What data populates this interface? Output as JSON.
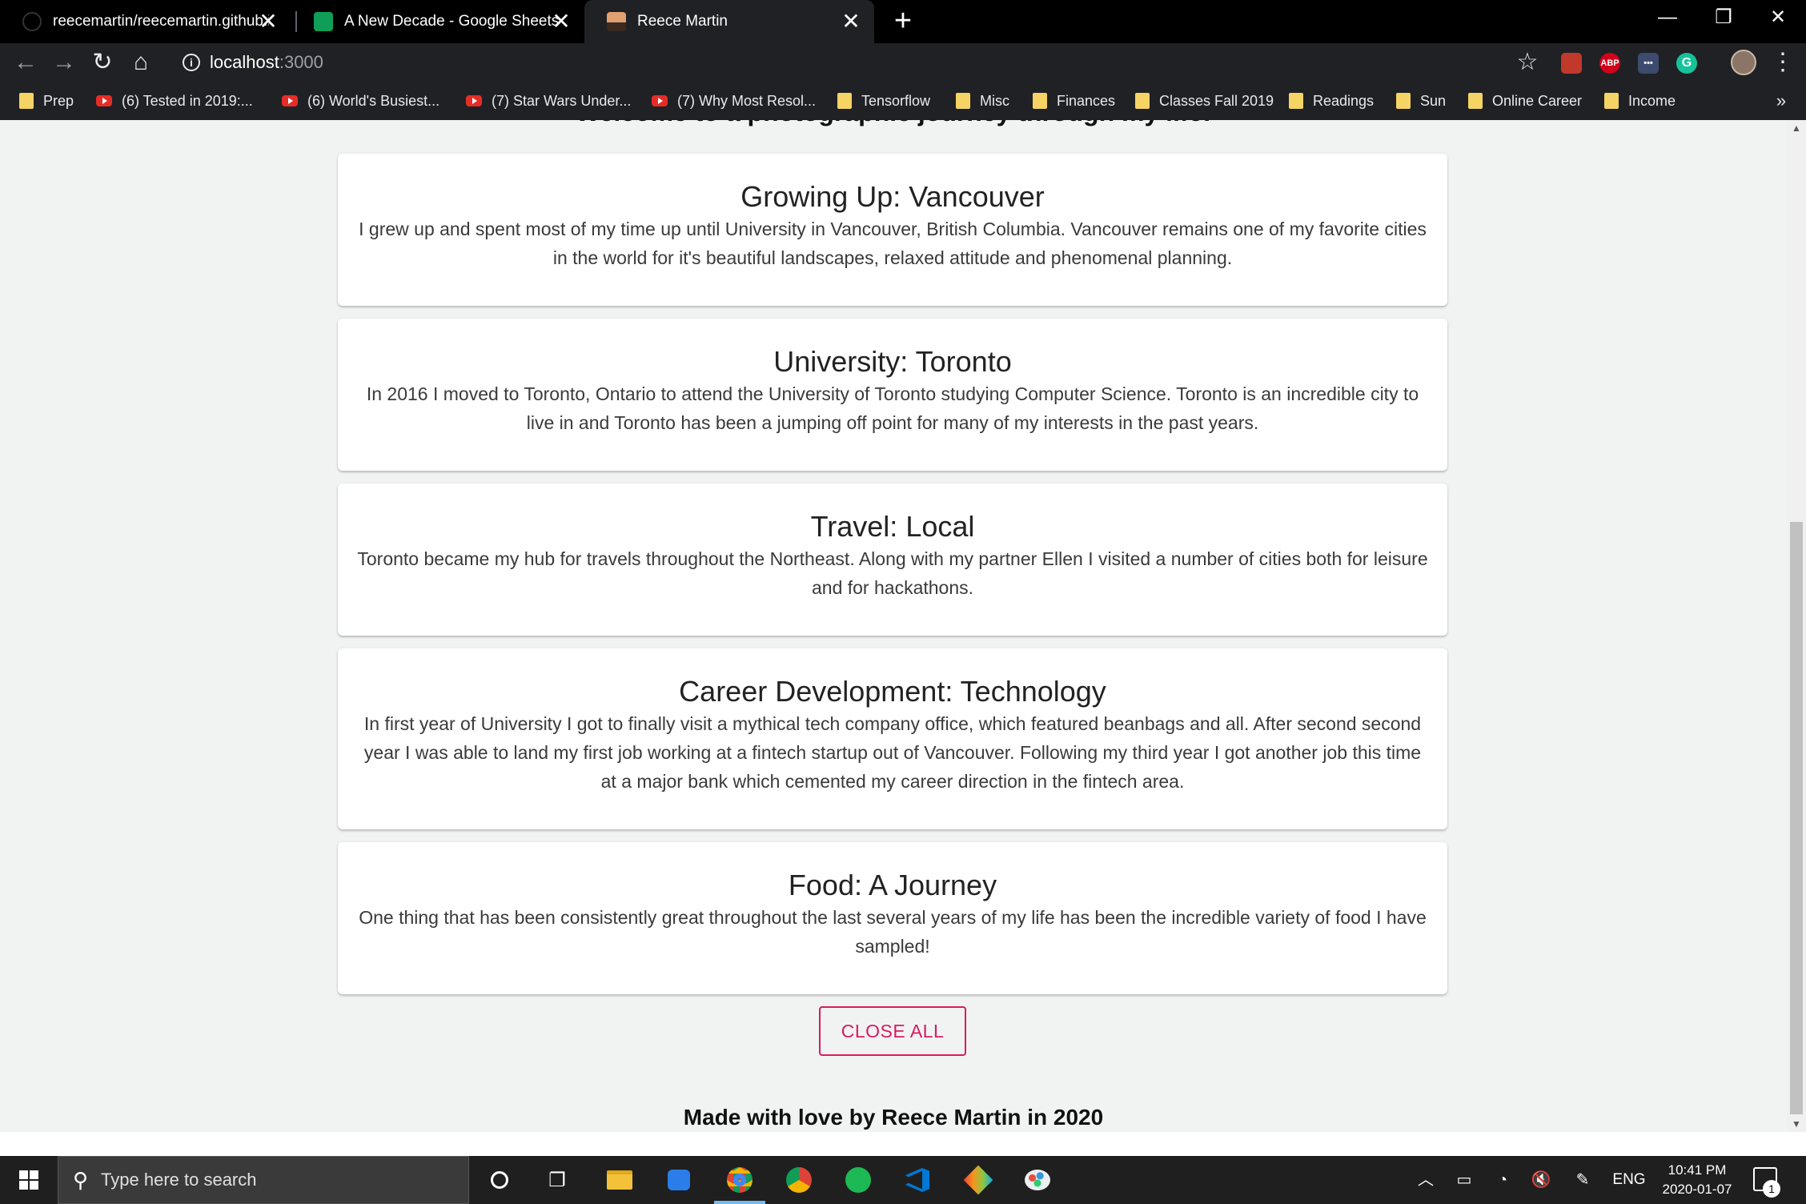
{
  "browser": {
    "tabs": [
      {
        "title": "reecemartin/reecemartin.github.i",
        "icon": "github-icon",
        "active": false
      },
      {
        "title": "A New Decade - Google Sheets",
        "icon": "google-sheets-icon",
        "active": false
      },
      {
        "title": "Reece Martin",
        "icon": "site-favicon",
        "active": true
      }
    ],
    "tab_close_glyph": "✕",
    "new_tab_glyph": "+",
    "window_controls": {
      "minimize": "—",
      "restore": "❐",
      "close": "✕"
    },
    "address": {
      "host": "localhost",
      "port": ":3000"
    },
    "nav": {
      "back": "←",
      "forward": "→",
      "reload": "↻",
      "home": "⌂",
      "bookmark_star": "☆",
      "menu": "⋮"
    },
    "extensions": [
      {
        "name": "extension-icon",
        "label": "",
        "color": "#c0392b"
      },
      {
        "name": "adblock-plus-icon",
        "label": "ABP",
        "color": "#d0021b"
      },
      {
        "name": "extension-dots-icon",
        "label": "•••",
        "color": "#3c4b6e"
      },
      {
        "name": "grammarly-icon",
        "label": "G",
        "color": "#15c39a"
      }
    ],
    "bookmarks": [
      {
        "label": "Prep",
        "type": "folder"
      },
      {
        "label": "(6) Tested in 2019:...",
        "type": "youtube"
      },
      {
        "label": "(6) World's Busiest...",
        "type": "youtube"
      },
      {
        "label": "(7) Star Wars Under...",
        "type": "youtube"
      },
      {
        "label": "(7) Why Most Resol...",
        "type": "youtube"
      },
      {
        "label": "Tensorflow",
        "type": "folder"
      },
      {
        "label": "Misc",
        "type": "folder"
      },
      {
        "label": "Finances",
        "type": "folder"
      },
      {
        "label": "Classes Fall 2019",
        "type": "folder"
      },
      {
        "label": "Readings",
        "type": "folder"
      },
      {
        "label": "Sun",
        "type": "folder"
      },
      {
        "label": "Online Career",
        "type": "folder"
      },
      {
        "label": "Income",
        "type": "folder"
      }
    ],
    "bookmarks_overflow": "»"
  },
  "page": {
    "heading_partial": "Welcome to a photographic journey through my life!",
    "cards": [
      {
        "title": "Growing Up: Vancouver",
        "body": "I grew up and spent most of my time up until University in Vancouver, British Columbia. Vancouver remains one of my favorite cities in the world for it's beautiful landscapes, relaxed attitude and phenomenal planning."
      },
      {
        "title": "University: Toronto",
        "body": "In 2016 I moved to Toronto, Ontario to attend the University of Toronto studying Computer Science. Toronto is an incredible city to live in and Toronto has been a jumping off point for many of my interests in the past years."
      },
      {
        "title": "Travel: Local",
        "body": "Toronto became my hub for travels throughout the Northeast. Along with my partner Ellen I visited a number of cities both for leisure and for hackathons."
      },
      {
        "title": "Career Development: Technology",
        "body": "In first year of University I got to finally visit a mythical tech company office, which featured beanbags and all. After second second year I was able to land my first job working at a fintech startup out of Vancouver. Following my third year I got another job this time at a major bank which cemented my career direction in the fintech area."
      },
      {
        "title": "Food: A Journey",
        "body": "One thing that has been consistently great throughout the last several years of my life has been the incredible variety of food I have sampled!"
      }
    ],
    "close_all_label": "CLOSE ALL",
    "footer": "Made with love by Reece Martin in 2020",
    "accent_color": "#d81b60"
  },
  "taskbar": {
    "search_placeholder": "Type here to search",
    "apps": [
      "cortana-icon",
      "task-view-icon",
      "file-explorer-icon",
      "messaging-icon",
      "chrome-icon",
      "chrome-icon",
      "spotify-icon",
      "vscode-icon",
      "git-icon",
      "paint-icon"
    ],
    "tray": {
      "language": "ENG",
      "time": "10:41 PM",
      "date": "2020-01-07",
      "notifications": "1"
    }
  }
}
